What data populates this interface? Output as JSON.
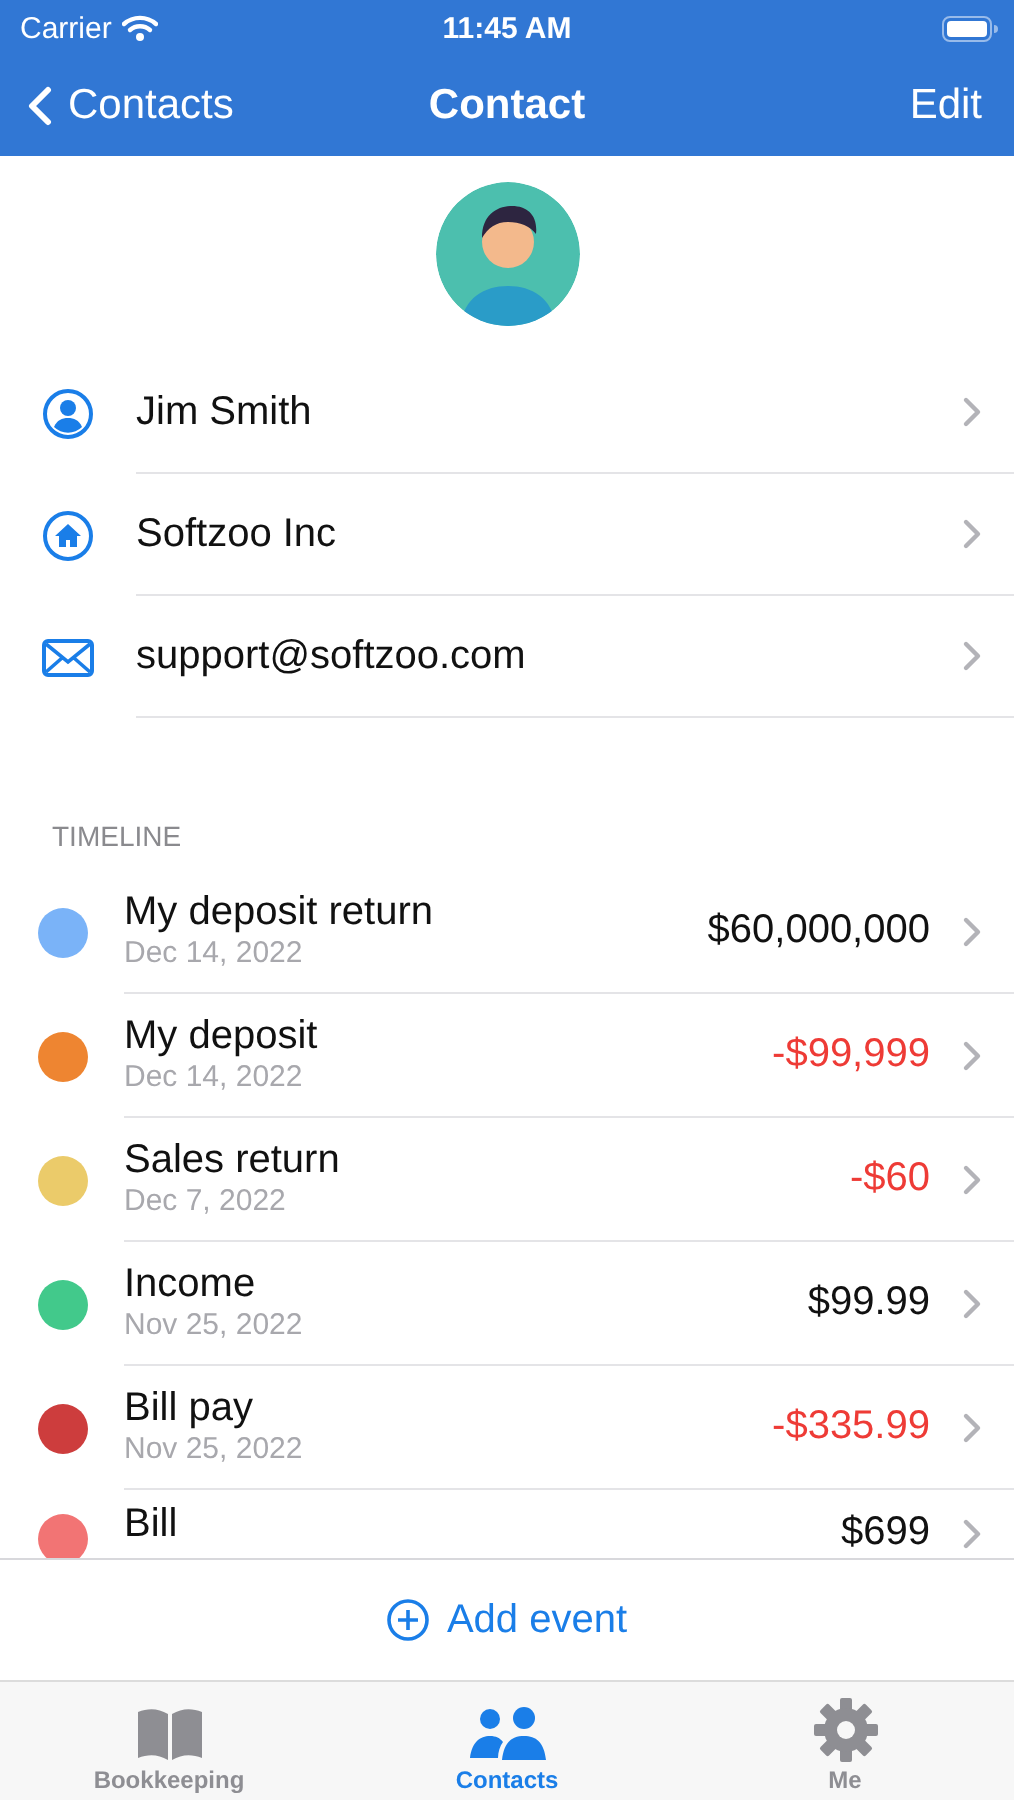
{
  "status_bar": {
    "carrier": "Carrier",
    "time": "11:45 AM"
  },
  "nav": {
    "back": "Contacts",
    "title": "Contact",
    "action": "Edit"
  },
  "contact_fields": [
    {
      "kind": "person",
      "value": "Jim Smith"
    },
    {
      "kind": "company",
      "value": "Softzoo Inc"
    },
    {
      "kind": "email",
      "value": "support@softzoo.com"
    }
  ],
  "timeline": {
    "header": "TIMELINE",
    "events": [
      {
        "title": "My deposit return",
        "date": "Dec 14, 2022",
        "amount": "$60,000,000",
        "negative": false,
        "color": "#7ab3f8"
      },
      {
        "title": "My deposit",
        "date": "Dec 14, 2022",
        "amount": "-$99,999",
        "negative": true,
        "color": "#ee8531"
      },
      {
        "title": "Sales return",
        "date": "Dec 7, 2022",
        "amount": "-$60",
        "negative": true,
        "color": "#ebcb6a"
      },
      {
        "title": "Income",
        "date": "Nov 25, 2022",
        "amount": "$99.99",
        "negative": false,
        "color": "#42c98b"
      },
      {
        "title": "Bill pay",
        "date": "Nov 25, 2022",
        "amount": "-$335.99",
        "negative": true,
        "color": "#cd3d3d"
      },
      {
        "title": "Bill",
        "amount": "$699",
        "negative": false,
        "color": "#f27474"
      }
    ]
  },
  "add_button": "Add event",
  "tabs": [
    {
      "kind": "book",
      "label": "Bookkeeping",
      "selected": false
    },
    {
      "kind": "people",
      "label": "Contacts",
      "selected": true
    },
    {
      "kind": "gear",
      "label": "Me",
      "selected": false
    }
  ]
}
